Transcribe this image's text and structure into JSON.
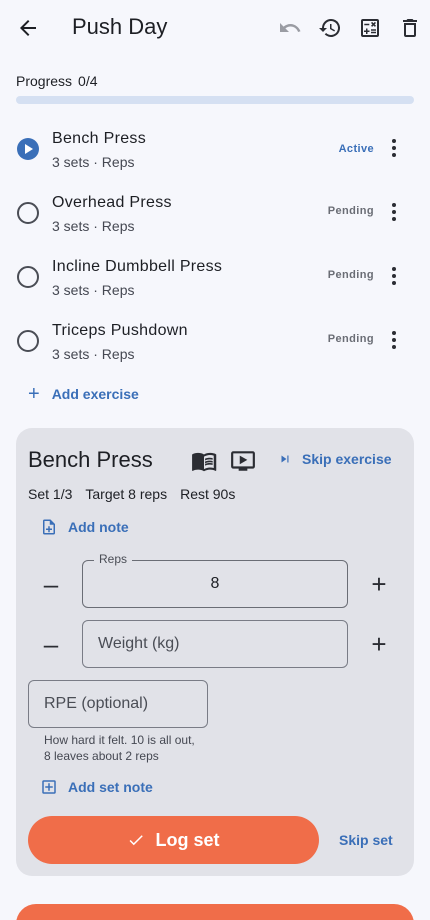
{
  "header": {
    "title": "Push Day",
    "icons": [
      "back-arrow-icon",
      "undo-icon",
      "history-icon",
      "calculator-icon",
      "trash-icon"
    ]
  },
  "progress": {
    "label": "Progress",
    "count": "0/4",
    "fraction": 0
  },
  "exercises": [
    {
      "name": "Bench Press",
      "summary": "3 sets · Reps",
      "status": "Active"
    },
    {
      "name": "Overhead Press",
      "summary": "3 sets · Reps",
      "status": "Pending"
    },
    {
      "name": "Incline Dumbbell Press",
      "summary": "3 sets · Reps",
      "status": "Pending"
    },
    {
      "name": "Triceps Pushdown",
      "summary": "3 sets · Reps",
      "status": "Pending"
    }
  ],
  "add_exercise_label": "Add exercise",
  "current": {
    "title": "Bench Press",
    "icons": [
      "book-icon",
      "video-icon",
      "skip-next-icon"
    ],
    "skip_exercise_label": "Skip exercise",
    "set_label": "Set 1/3",
    "target_label": "Target 8 reps",
    "rest_label": "Rest 90s",
    "add_note_label": "Add note",
    "reps": {
      "label": "Reps",
      "value": "8"
    },
    "weight": {
      "placeholder": "Weight (kg)",
      "value": ""
    },
    "rpe": {
      "placeholder": "RPE (optional)",
      "value": "",
      "helper": "How hard it felt. 10 is all out, 8 leaves about 2 reps"
    },
    "add_set_note_label": "Add set note",
    "log_set_label": "Log set",
    "skip_set_label": "Skip set"
  },
  "colors": {
    "accent": "#3a6fb8",
    "primary_action": "#f06d49",
    "card": "#e1e2e8",
    "background": "#f6f7fc"
  }
}
